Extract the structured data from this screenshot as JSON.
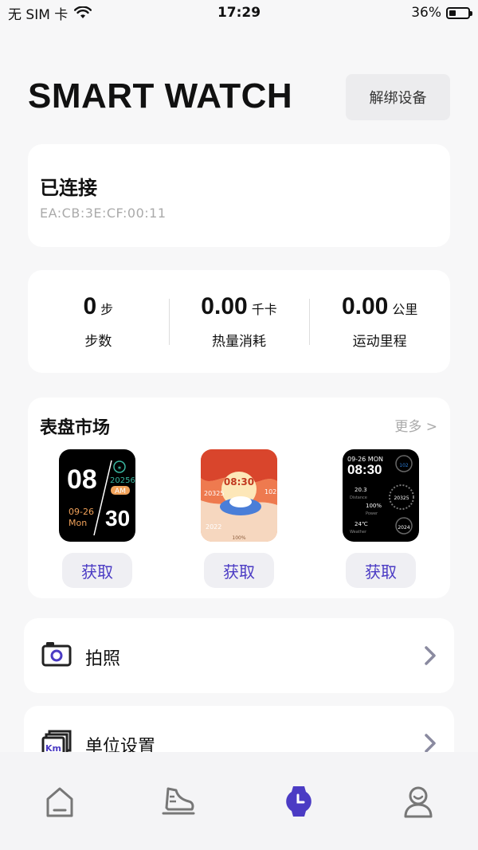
{
  "status_bar": {
    "carrier": "无 SIM 卡",
    "time": "17:29",
    "battery": "36%",
    "battery_level": 0.36
  },
  "header": {
    "title": "SMART WATCH",
    "unbind_label": "解绑设备"
  },
  "connection": {
    "status": "已连接",
    "mac": "EA:CB:3E:CF:00:11"
  },
  "stats": [
    {
      "value": "0",
      "unit": "步",
      "label": "步数"
    },
    {
      "value": "0.00",
      "unit": "千卡",
      "label": "热量消耗"
    },
    {
      "value": "0.00",
      "unit": "公里",
      "label": "运动里程"
    }
  ],
  "market": {
    "title": "表盘市场",
    "more": "更多 >",
    "get_label": "获取",
    "faces": [
      {
        "name": "watch-face-1",
        "hour": "08",
        "minute": "30",
        "steps": "20256",
        "ampm": "AM",
        "date": "09-26",
        "weekday": "Mon",
        "accent": "#39b6a0"
      },
      {
        "name": "watch-face-2",
        "time": "08:30",
        "steps": "20325",
        "heart": "102",
        "year": "2022",
        "battery": "100%",
        "accent": "#e8573a"
      },
      {
        "name": "watch-face-3",
        "date": "09-26 MON",
        "time": "08:30",
        "distance": "20.3",
        "distance_label": "Distance",
        "power": "100%",
        "power_label": "Power",
        "temp": "24℃",
        "temp_label": "Weather",
        "heart": "102",
        "steps": "20325",
        "year": "2024",
        "accent": "#2a7cd6"
      }
    ]
  },
  "menu": [
    {
      "label": "拍照",
      "icon": "camera-icon"
    },
    {
      "label": "单位设置",
      "icon": "unit-km-icon"
    }
  ],
  "tab_bar": {
    "tabs": [
      {
        "icon": "home-icon",
        "active": false
      },
      {
        "icon": "shoe-icon",
        "active": false
      },
      {
        "icon": "watch-icon",
        "active": true
      },
      {
        "icon": "profile-icon",
        "active": false
      }
    ],
    "active_color": "#4b3bc4",
    "inactive_color": "#777"
  }
}
